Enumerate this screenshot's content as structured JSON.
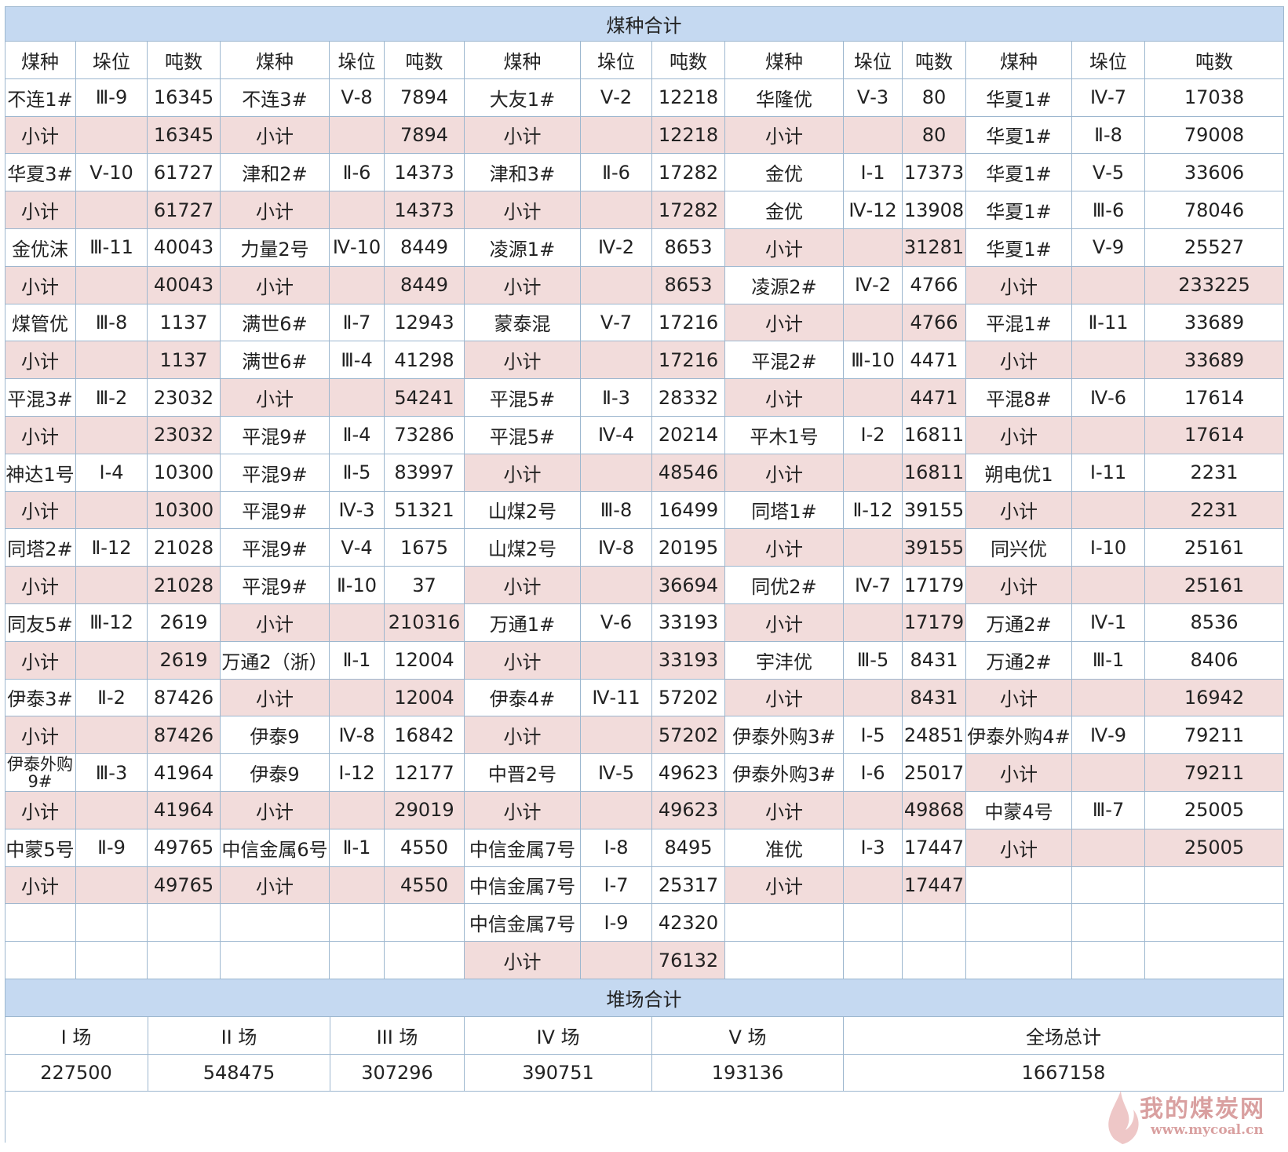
{
  "section_title": "煤种合计",
  "headers": [
    "煤种",
    "垛位",
    "吨数",
    "煤种",
    "垛位",
    "吨数",
    "煤种",
    "垛位",
    "吨数",
    "煤种",
    "垛位",
    "吨数",
    "煤种",
    "垛位",
    "吨数"
  ],
  "rows": [
    [
      "不连1#",
      "Ⅲ-9",
      "16345",
      "不连3#",
      "Ⅴ-8",
      "7894",
      "大友1#",
      "Ⅴ-2",
      "12218",
      "华隆优",
      "Ⅴ-3",
      "80",
      "华夏1#",
      "Ⅳ-7",
      "17038"
    ],
    [
      "小计",
      "",
      "16345",
      "小计",
      "",
      "7894",
      "小计",
      "",
      "12218",
      "小计",
      "",
      "80",
      "华夏1#",
      "Ⅱ-8",
      "79008"
    ],
    [
      "华夏3#",
      "Ⅴ-10",
      "61727",
      "津和2#",
      "Ⅱ-6",
      "14373",
      "津和3#",
      "Ⅱ-6",
      "17282",
      "金优",
      "Ⅰ-1",
      "17373",
      "华夏1#",
      "Ⅴ-5",
      "33606"
    ],
    [
      "小计",
      "",
      "61727",
      "小计",
      "",
      "14373",
      "小计",
      "",
      "17282",
      "金优",
      "Ⅳ-12",
      "13908",
      "华夏1#",
      "Ⅲ-6",
      "78046"
    ],
    [
      "金优沫",
      "Ⅲ-11",
      "40043",
      "力量2号",
      "Ⅳ-10",
      "8449",
      "凌源1#",
      "Ⅳ-2",
      "8653",
      "小计",
      "",
      "31281",
      "华夏1#",
      "Ⅴ-9",
      "25527"
    ],
    [
      "小计",
      "",
      "40043",
      "小计",
      "",
      "8449",
      "小计",
      "",
      "8653",
      "凌源2#",
      "Ⅳ-2",
      "4766",
      "小计",
      "",
      "233225"
    ],
    [
      "煤管优",
      "Ⅲ-8",
      "1137",
      "满世6#",
      "Ⅱ-7",
      "12943",
      "蒙泰混",
      "Ⅴ-7",
      "17216",
      "小计",
      "",
      "4766",
      "平混1#",
      "Ⅱ-11",
      "33689"
    ],
    [
      "小计",
      "",
      "1137",
      "满世6#",
      "Ⅲ-4",
      "41298",
      "小计",
      "",
      "17216",
      "平混2#",
      "Ⅲ-10",
      "4471",
      "小计",
      "",
      "33689"
    ],
    [
      "平混3#",
      "Ⅲ-2",
      "23032",
      "小计",
      "",
      "54241",
      "平混5#",
      "Ⅱ-3",
      "28332",
      "小计",
      "",
      "4471",
      "平混8#",
      "Ⅳ-6",
      "17614"
    ],
    [
      "小计",
      "",
      "23032",
      "平混9#",
      "Ⅱ-4",
      "73286",
      "平混5#",
      "Ⅳ-4",
      "20214",
      "平木1号",
      "Ⅰ-2",
      "16811",
      "小计",
      "",
      "17614"
    ],
    [
      "神达1号",
      "Ⅰ-4",
      "10300",
      "平混9#",
      "Ⅱ-5",
      "83997",
      "小计",
      "",
      "48546",
      "小计",
      "",
      "16811",
      "朔电优1",
      "Ⅰ-11",
      "2231"
    ],
    [
      "小计",
      "",
      "10300",
      "平混9#",
      "Ⅳ-3",
      "51321",
      "山煤2号",
      "Ⅲ-8",
      "16499",
      "同塔1#",
      "Ⅱ-12",
      "39155",
      "小计",
      "",
      "2231"
    ],
    [
      "同塔2#",
      "Ⅱ-12",
      "21028",
      "平混9#",
      "Ⅴ-4",
      "1675",
      "山煤2号",
      "Ⅳ-8",
      "20195",
      "小计",
      "",
      "39155",
      "同兴优",
      "Ⅰ-10",
      "25161"
    ],
    [
      "小计",
      "",
      "21028",
      "平混9#",
      "Ⅱ-10",
      "37",
      "小计",
      "",
      "36694",
      "同优2#",
      "Ⅳ-7",
      "17179",
      "小计",
      "",
      "25161"
    ],
    [
      "同友5#",
      "Ⅲ-12",
      "2619",
      "小计",
      "",
      "210316",
      "万通1#",
      "Ⅴ-6",
      "33193",
      "小计",
      "",
      "17179",
      "万通2#",
      "Ⅳ-1",
      "8536"
    ],
    [
      "小计",
      "",
      "2619",
      "万通2（浙）",
      "Ⅱ-1",
      "12004",
      "小计",
      "",
      "33193",
      "宇沣优",
      "Ⅲ-5",
      "8431",
      "万通2#",
      "Ⅲ-1",
      "8406"
    ],
    [
      "伊泰3#",
      "Ⅱ-2",
      "87426",
      "小计",
      "",
      "12004",
      "伊泰4#",
      "Ⅳ-11",
      "57202",
      "小计",
      "",
      "8431",
      "小计",
      "",
      "16942"
    ],
    [
      "小计",
      "",
      "87426",
      "伊泰9",
      "Ⅳ-8",
      "16842",
      "小计",
      "",
      "57202",
      "伊泰外购3#",
      "Ⅰ-5",
      "24851",
      "伊泰外购4#",
      "Ⅳ-9",
      "79211"
    ],
    [
      "伊泰外购9#",
      "Ⅲ-3",
      "41964",
      "伊泰9",
      "Ⅰ-12",
      "12177",
      "中晋2号",
      "Ⅳ-5",
      "49623",
      "伊泰外购3#",
      "Ⅰ-6",
      "25017",
      "小计",
      "",
      "79211"
    ],
    [
      "小计",
      "",
      "41964",
      "小计",
      "",
      "29019",
      "小计",
      "",
      "49623",
      "小计",
      "",
      "49868",
      "中蒙4号",
      "Ⅲ-7",
      "25005"
    ],
    [
      "中蒙5号",
      "Ⅱ-9",
      "49765",
      "中信金属6号",
      "Ⅱ-1",
      "4550",
      "中信金属7号",
      "Ⅰ-8",
      "8495",
      "准优",
      "Ⅰ-3",
      "17447",
      "小计",
      "",
      "25005"
    ],
    [
      "小计",
      "",
      "49765",
      "小计",
      "",
      "4550",
      "中信金属7号",
      "Ⅰ-7",
      "25317",
      "小计",
      "",
      "17447",
      "",
      "",
      ""
    ],
    [
      "",
      "",
      "",
      "",
      "",
      "",
      "中信金属7号",
      "Ⅰ-9",
      "42320",
      "",
      "",
      "",
      "",
      "",
      ""
    ],
    [
      "",
      "",
      "",
      "",
      "",
      "",
      "小计",
      "",
      "76132",
      "",
      "",
      "",
      "",
      "",
      ""
    ]
  ],
  "yard_title": "堆场合计",
  "yard_headers": [
    "I 场",
    "II 场",
    "III 场",
    "IV 场",
    "V 场",
    "全场总计"
  ],
  "yard_values": [
    "227500",
    "548475",
    "307296",
    "390751",
    "193136",
    "1667158"
  ],
  "watermark_text": "我的煤炭网",
  "watermark_url": "www.mycoal.cn",
  "colors": {
    "header_band": "#c5d9f1",
    "subtotal_fill": "#f2dcdb",
    "grid": "#9db7cf"
  }
}
